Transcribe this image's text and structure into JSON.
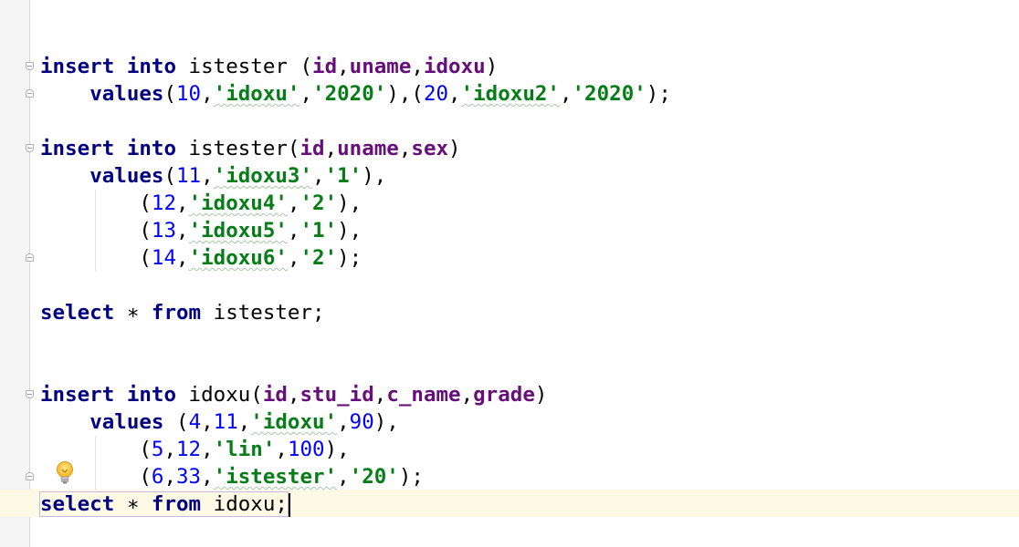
{
  "editor": {
    "lines": [
      {
        "name": "line-1",
        "tokens": [
          {
            "t": "insert",
            "c": "kw"
          },
          {
            "t": " ",
            "c": "plain"
          },
          {
            "t": "into",
            "c": "kw"
          },
          {
            "t": " istester (",
            "c": "plain"
          },
          {
            "t": "id",
            "c": "col"
          },
          {
            "t": ",",
            "c": "plain"
          },
          {
            "t": "uname",
            "c": "col"
          },
          {
            "t": ",",
            "c": "plain"
          },
          {
            "t": "idoxu",
            "c": "col"
          },
          {
            "t": ")",
            "c": "plain"
          }
        ]
      },
      {
        "name": "line-2",
        "tokens": [
          {
            "t": "    ",
            "c": "plain"
          },
          {
            "t": "values",
            "c": "kw"
          },
          {
            "t": "(",
            "c": "plain"
          },
          {
            "t": "10",
            "c": "num"
          },
          {
            "t": ",",
            "c": "plain"
          },
          {
            "t": "'idoxu'",
            "c": "str sq"
          },
          {
            "t": ",",
            "c": "plain"
          },
          {
            "t": "'2020'",
            "c": "str"
          },
          {
            "t": "),(",
            "c": "plain"
          },
          {
            "t": "20",
            "c": "num"
          },
          {
            "t": ",",
            "c": "plain"
          },
          {
            "t": "'idoxu2'",
            "c": "str sq"
          },
          {
            "t": ",",
            "c": "plain"
          },
          {
            "t": "'2020'",
            "c": "str"
          },
          {
            "t": ");",
            "c": "plain"
          }
        ]
      },
      {
        "name": "line-3",
        "tokens": []
      },
      {
        "name": "line-4",
        "tokens": [
          {
            "t": "insert",
            "c": "kw"
          },
          {
            "t": " ",
            "c": "plain"
          },
          {
            "t": "into",
            "c": "kw"
          },
          {
            "t": " istester(",
            "c": "plain"
          },
          {
            "t": "id",
            "c": "col"
          },
          {
            "t": ",",
            "c": "plain"
          },
          {
            "t": "uname",
            "c": "col"
          },
          {
            "t": ",",
            "c": "plain"
          },
          {
            "t": "sex",
            "c": "col"
          },
          {
            "t": ")",
            "c": "plain"
          }
        ]
      },
      {
        "name": "line-5",
        "tokens": [
          {
            "t": "    ",
            "c": "plain"
          },
          {
            "t": "values",
            "c": "kw"
          },
          {
            "t": "(",
            "c": "plain"
          },
          {
            "t": "11",
            "c": "num"
          },
          {
            "t": ",",
            "c": "plain"
          },
          {
            "t": "'idoxu3'",
            "c": "str sq"
          },
          {
            "t": ",",
            "c": "plain"
          },
          {
            "t": "'1'",
            "c": "str"
          },
          {
            "t": "),",
            "c": "plain"
          }
        ]
      },
      {
        "name": "line-6",
        "tokens": [
          {
            "t": "        (",
            "c": "plain"
          },
          {
            "t": "12",
            "c": "num"
          },
          {
            "t": ",",
            "c": "plain"
          },
          {
            "t": "'idoxu4'",
            "c": "str sq"
          },
          {
            "t": ",",
            "c": "plain"
          },
          {
            "t": "'2'",
            "c": "str"
          },
          {
            "t": "),",
            "c": "plain"
          }
        ]
      },
      {
        "name": "line-7",
        "tokens": [
          {
            "t": "        (",
            "c": "plain"
          },
          {
            "t": "13",
            "c": "num"
          },
          {
            "t": ",",
            "c": "plain"
          },
          {
            "t": "'idoxu5'",
            "c": "str sq"
          },
          {
            "t": ",",
            "c": "plain"
          },
          {
            "t": "'1'",
            "c": "str"
          },
          {
            "t": "),",
            "c": "plain"
          }
        ]
      },
      {
        "name": "line-8",
        "tokens": [
          {
            "t": "        (",
            "c": "plain"
          },
          {
            "t": "14",
            "c": "num"
          },
          {
            "t": ",",
            "c": "plain"
          },
          {
            "t": "'idoxu6'",
            "c": "str sq"
          },
          {
            "t": ",",
            "c": "plain"
          },
          {
            "t": "'2'",
            "c": "str"
          },
          {
            "t": ");",
            "c": "plain"
          }
        ]
      },
      {
        "name": "line-9",
        "tokens": []
      },
      {
        "name": "line-10",
        "tokens": [
          {
            "t": "select",
            "c": "kw"
          },
          {
            "t": " ∗ ",
            "c": "plain"
          },
          {
            "t": "from",
            "c": "kw"
          },
          {
            "t": " istester;",
            "c": "plain"
          }
        ]
      },
      {
        "name": "line-11",
        "tokens": []
      },
      {
        "name": "line-12",
        "tokens": []
      },
      {
        "name": "line-13",
        "tokens": [
          {
            "t": "insert",
            "c": "kw"
          },
          {
            "t": " ",
            "c": "plain"
          },
          {
            "t": "into",
            "c": "kw"
          },
          {
            "t": " idoxu(",
            "c": "plain"
          },
          {
            "t": "id",
            "c": "col"
          },
          {
            "t": ",",
            "c": "plain"
          },
          {
            "t": "stu_id",
            "c": "col"
          },
          {
            "t": ",",
            "c": "plain"
          },
          {
            "t": "c_name",
            "c": "col"
          },
          {
            "t": ",",
            "c": "plain"
          },
          {
            "t": "grade",
            "c": "col"
          },
          {
            "t": ")",
            "c": "plain"
          }
        ]
      },
      {
        "name": "line-14",
        "tokens": [
          {
            "t": "    ",
            "c": "plain"
          },
          {
            "t": "values",
            "c": "kw"
          },
          {
            "t": " (",
            "c": "plain"
          },
          {
            "t": "4",
            "c": "num"
          },
          {
            "t": ",",
            "c": "plain"
          },
          {
            "t": "11",
            "c": "num"
          },
          {
            "t": ",",
            "c": "plain"
          },
          {
            "t": "'idoxu'",
            "c": "str sq"
          },
          {
            "t": ",",
            "c": "plain"
          },
          {
            "t": "90",
            "c": "num"
          },
          {
            "t": "),",
            "c": "plain"
          }
        ]
      },
      {
        "name": "line-15",
        "tokens": [
          {
            "t": "        (",
            "c": "plain"
          },
          {
            "t": "5",
            "c": "num"
          },
          {
            "t": ",",
            "c": "plain"
          },
          {
            "t": "12",
            "c": "num"
          },
          {
            "t": ",",
            "c": "plain"
          },
          {
            "t": "'lin'",
            "c": "str"
          },
          {
            "t": ",",
            "c": "plain"
          },
          {
            "t": "100",
            "c": "num"
          },
          {
            "t": "),",
            "c": "plain"
          }
        ]
      },
      {
        "name": "line-16",
        "tokens": [
          {
            "t": "        (",
            "c": "plain"
          },
          {
            "t": "6",
            "c": "num"
          },
          {
            "t": ",",
            "c": "plain"
          },
          {
            "t": "33",
            "c": "num"
          },
          {
            "t": ",",
            "c": "plain"
          },
          {
            "t": "'istester'",
            "c": "str sq"
          },
          {
            "t": ",",
            "c": "plain"
          },
          {
            "t": "'20'",
            "c": "str"
          },
          {
            "t": ");",
            "c": "plain"
          }
        ]
      },
      {
        "name": "line-17",
        "tokens": [
          {
            "t": "select",
            "c": "kw"
          },
          {
            "t": " ∗ ",
            "c": "plain"
          },
          {
            "t": "from",
            "c": "kw"
          },
          {
            "t": " idoxu;",
            "c": "plain"
          }
        ],
        "current": true
      }
    ]
  },
  "colors": {
    "keyword": "#000080",
    "column": "#660e7a",
    "number": "#0000ff",
    "string": "#067d17",
    "caret_line": "#fcfae5",
    "gutter": "#f5f5f5"
  },
  "icons": {
    "intention": "lightbulb-icon",
    "fold": "fold-marker-icon"
  }
}
